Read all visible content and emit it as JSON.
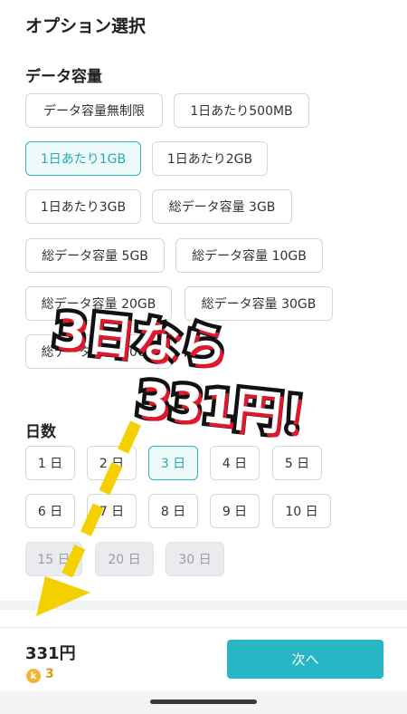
{
  "title": "オプション選択",
  "data_section": {
    "label": "データ容量",
    "options": [
      {
        "label": "データ容量無制限"
      },
      {
        "label": "1日あたり500MB"
      },
      {
        "label": "1日あたり1GB"
      },
      {
        "label": "1日あたり2GB"
      },
      {
        "label": "1日あたり3GB"
      },
      {
        "label": "総データ容量 3GB"
      },
      {
        "label": "総データ容量 5GB"
      },
      {
        "label": "総データ容量 10GB"
      },
      {
        "label": "総データ容量 20GB"
      },
      {
        "label": "総データ容量 30GB"
      },
      {
        "label": "総データ容量 50GB"
      }
    ],
    "selected": "1日あたり1GB"
  },
  "days_section": {
    "label": "日数",
    "options": [
      {
        "label": "1 日"
      },
      {
        "label": "2 日"
      },
      {
        "label": "3 日"
      },
      {
        "label": "4 日"
      },
      {
        "label": "5 日"
      },
      {
        "label": "6 日"
      },
      {
        "label": "7 日"
      },
      {
        "label": "8 日"
      },
      {
        "label": "9 日"
      },
      {
        "label": "10 日"
      },
      {
        "label": "15 日"
      },
      {
        "label": "20 日"
      },
      {
        "label": "30 日"
      }
    ],
    "selected": "3 日",
    "disabled": [
      "15 日",
      "20 日",
      "30 日"
    ]
  },
  "footer": {
    "price": "331円",
    "coin_letter": "k",
    "points": "3",
    "next_label": "次へ"
  },
  "callout": {
    "line1": "3日なら",
    "line2": "331円！"
  },
  "colors": {
    "accent": "#27b6c3",
    "arrow": "#f5d000",
    "callout_shadow": "#e0182c"
  }
}
